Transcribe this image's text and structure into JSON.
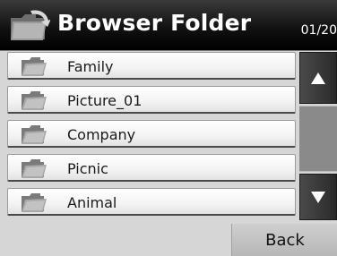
{
  "header": {
    "title": "Browser Folder",
    "page_count": "01/20",
    "icon": "folder-back-icon"
  },
  "folders": [
    {
      "label": "Family",
      "icon": "folder-icon"
    },
    {
      "label": "Picture_01",
      "icon": "folder-icon"
    },
    {
      "label": "Company",
      "icon": "folder-icon"
    },
    {
      "label": "Picnic",
      "icon": "folder-icon"
    },
    {
      "label": "Animal",
      "icon": "folder-icon"
    }
  ],
  "scroll": {
    "up_icon": "triangle-up-icon",
    "down_icon": "triangle-down-icon"
  },
  "footer": {
    "back_label": "Back"
  },
  "colors": {
    "header_bg": "#000000",
    "background": "#d6d6d6",
    "scroll_button": "#3a3a3a",
    "folder": "#8a8a8a"
  }
}
